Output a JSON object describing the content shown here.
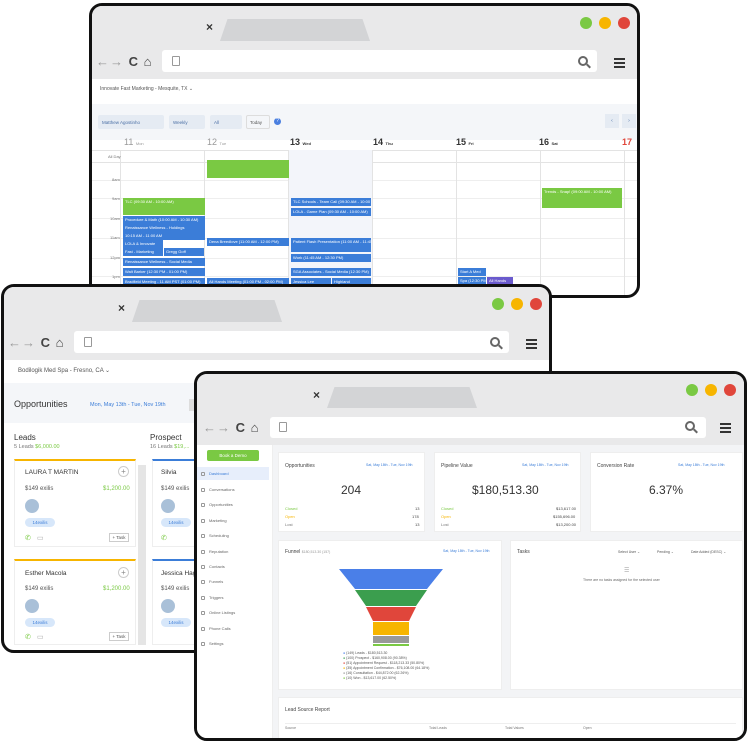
{
  "calendar": {
    "location": "Innovate Fast Marketing - Mesquite, TX",
    "user_select": "Matthew Agostinho",
    "view_select": "Weekly",
    "all_select": "All",
    "today_btn": "Today",
    "help": "?",
    "allday": "All Day",
    "days": [
      {
        "num": "11",
        "name": "Mon"
      },
      {
        "num": "12",
        "name": "Tue"
      },
      {
        "num": "13",
        "name": "Wed"
      },
      {
        "num": "14",
        "name": "Thu"
      },
      {
        "num": "15",
        "name": "Fri"
      },
      {
        "num": "16",
        "name": "Sat"
      },
      {
        "num": "17",
        "name": ""
      }
    ],
    "hours": [
      "8am",
      "9am",
      "10am",
      "11am",
      "12pm",
      "1pm"
    ],
    "events": [
      {
        "label": "",
        "color": "green"
      },
      {
        "label": "TLC (09:30 AM - 10:00 AM)",
        "color": "green"
      },
      {
        "label": "Procedure & Math (10:00 AM - 10:30 AM)",
        "color": "blue"
      },
      {
        "label": "Renaissance Wellness - Holdings",
        "color": "blue"
      },
      {
        "label": "10:15 AM - 11:00 AM",
        "color": "blue"
      },
      {
        "label": "LOLA & Innovate",
        "color": "blue"
      },
      {
        "label": "Fast - Marketing",
        "color": "blue"
      },
      {
        "label": "Gregg Goff",
        "color": "blue"
      },
      {
        "label": "Renaissance Wellness - Social Media",
        "color": "blue"
      },
      {
        "label": "Walt Barker (12:30 PM - 01:00 PM)",
        "color": "blue"
      },
      {
        "label": "Bradfield Meeting - 11 AM PST (01:00 PM)",
        "color": "blue"
      },
      {
        "label": "Dena Breedlove (11:00 AM - 12:00 PM)",
        "color": "blue"
      },
      {
        "label": "All Hands Meeting (01:00 PM - 02:00 PM)",
        "color": "blue"
      },
      {
        "label": "TLC Schools - Team Call (09:30 AM - 10:00 AM)",
        "color": "blue"
      },
      {
        "label": "LOLA - Game Plan (09:30 AM - 10:00 AM)",
        "color": "blue"
      },
      {
        "label": "Patient Flash Presentation (11:00 AM - 11:45 AM)",
        "color": "blue"
      },
      {
        "label": "Work (11:45 AM - 12:30 PM)",
        "color": "blue"
      },
      {
        "label": "SGA Associates - Social Media (12:30 PM)",
        "color": "blue"
      },
      {
        "label": "Jessica Lee",
        "color": "blue"
      },
      {
        "label": "Highland",
        "color": "blue"
      },
      {
        "label": "Start A Med",
        "color": "blue"
      },
      {
        "label": "Spa (12:30 PM)",
        "color": "blue"
      },
      {
        "label": "All Hands",
        "color": "purple"
      },
      {
        "label": "Trends - Snap! (09:00 AM - 10:00 AM)",
        "color": "green"
      }
    ]
  },
  "opps": {
    "location": "Bodilogik Med Spa - Fresno, CA",
    "title": "Opportunities",
    "date_range": "Mon, May 13th - Tue, Nov 19th",
    "col1": {
      "title": "Leads",
      "count": "5 Leads",
      "amount": "$6,000.00"
    },
    "col2": {
      "title": "Prospect",
      "count": "16 Leads",
      "amount": "$19,..."
    },
    "cards": [
      {
        "name": "LAURA T MARTIN",
        "price": "$149 exilis",
        "value": "$1,200.00",
        "tag": "14exilis",
        "task": "+ Task"
      },
      {
        "name": "Esther Macola",
        "price": "$149 exilis",
        "value": "$1,200.00",
        "tag": "14exilis",
        "task": "+ Task"
      }
    ],
    "cards2": [
      {
        "name": "Silvia",
        "price": "$149 exilis",
        "tag": "14exilis"
      },
      {
        "name": "Jessica Hag",
        "price": "$149 exilis",
        "tag": "14exilis"
      }
    ]
  },
  "dash": {
    "cta": "Book a Demo",
    "nav": [
      "Dashboard",
      "Conversations",
      "Opportunities",
      "Marketing",
      "Scheduling",
      "Reputation",
      "Contacts",
      "Funnels",
      "Triggers",
      "Online Listings",
      "Phone Calls",
      "Settings"
    ],
    "opp_card": {
      "title": "Opportunities",
      "range": "Sat, May 18th - Tue, Nov 19th",
      "value": "204",
      "rows": [
        {
          "k": "Closed",
          "v": "13"
        },
        {
          "k": "Open",
          "v": "178"
        },
        {
          "k": "Lost",
          "v": "13"
        }
      ]
    },
    "pipe_card": {
      "title": "Pipeline Value",
      "range": "Sat, May 18th - Tue, Nov 19th",
      "value": "$180,513.30",
      "rows": [
        {
          "k": "Closed",
          "v": "$13,617.00"
        },
        {
          "k": "Open",
          "v": "$155,696.00"
        },
        {
          "k": "Lost",
          "v": "$13,200.00"
        }
      ]
    },
    "conv_card": {
      "title": "Conversion Rate",
      "range": "Sat, May 18th - Tue, Nov 19th",
      "value": "6.37%"
    },
    "funnel": {
      "title": "Funnel",
      "sub": "$180,513.30 (157)",
      "range": "Sat, May 18th - Tue, Nov 19th",
      "legend": [
        "(149) Leads - $180,513.30",
        "(100) Prospect - $160,908.00 (90.38%)",
        "(51) Appointment Request - $118,213.33 (50.80%)",
        "(35) Appointment Confirmation - $76,108.00 (64.18%)",
        "(16) Consultation - $44,872.00 (62.26%)",
        "(10) Won - $13,617.00 (62.50%)"
      ]
    },
    "tasks": {
      "title": "Tasks",
      "select_user": "Select User",
      "pending": "Pending",
      "sort": "Date Added (DESC)",
      "empty": "There are no tasks assigned for the selected user"
    },
    "lead_report": {
      "title": "Lead Source Report",
      "cols": [
        "Source",
        "Total Leads",
        "Total Values",
        "Open"
      ]
    }
  }
}
